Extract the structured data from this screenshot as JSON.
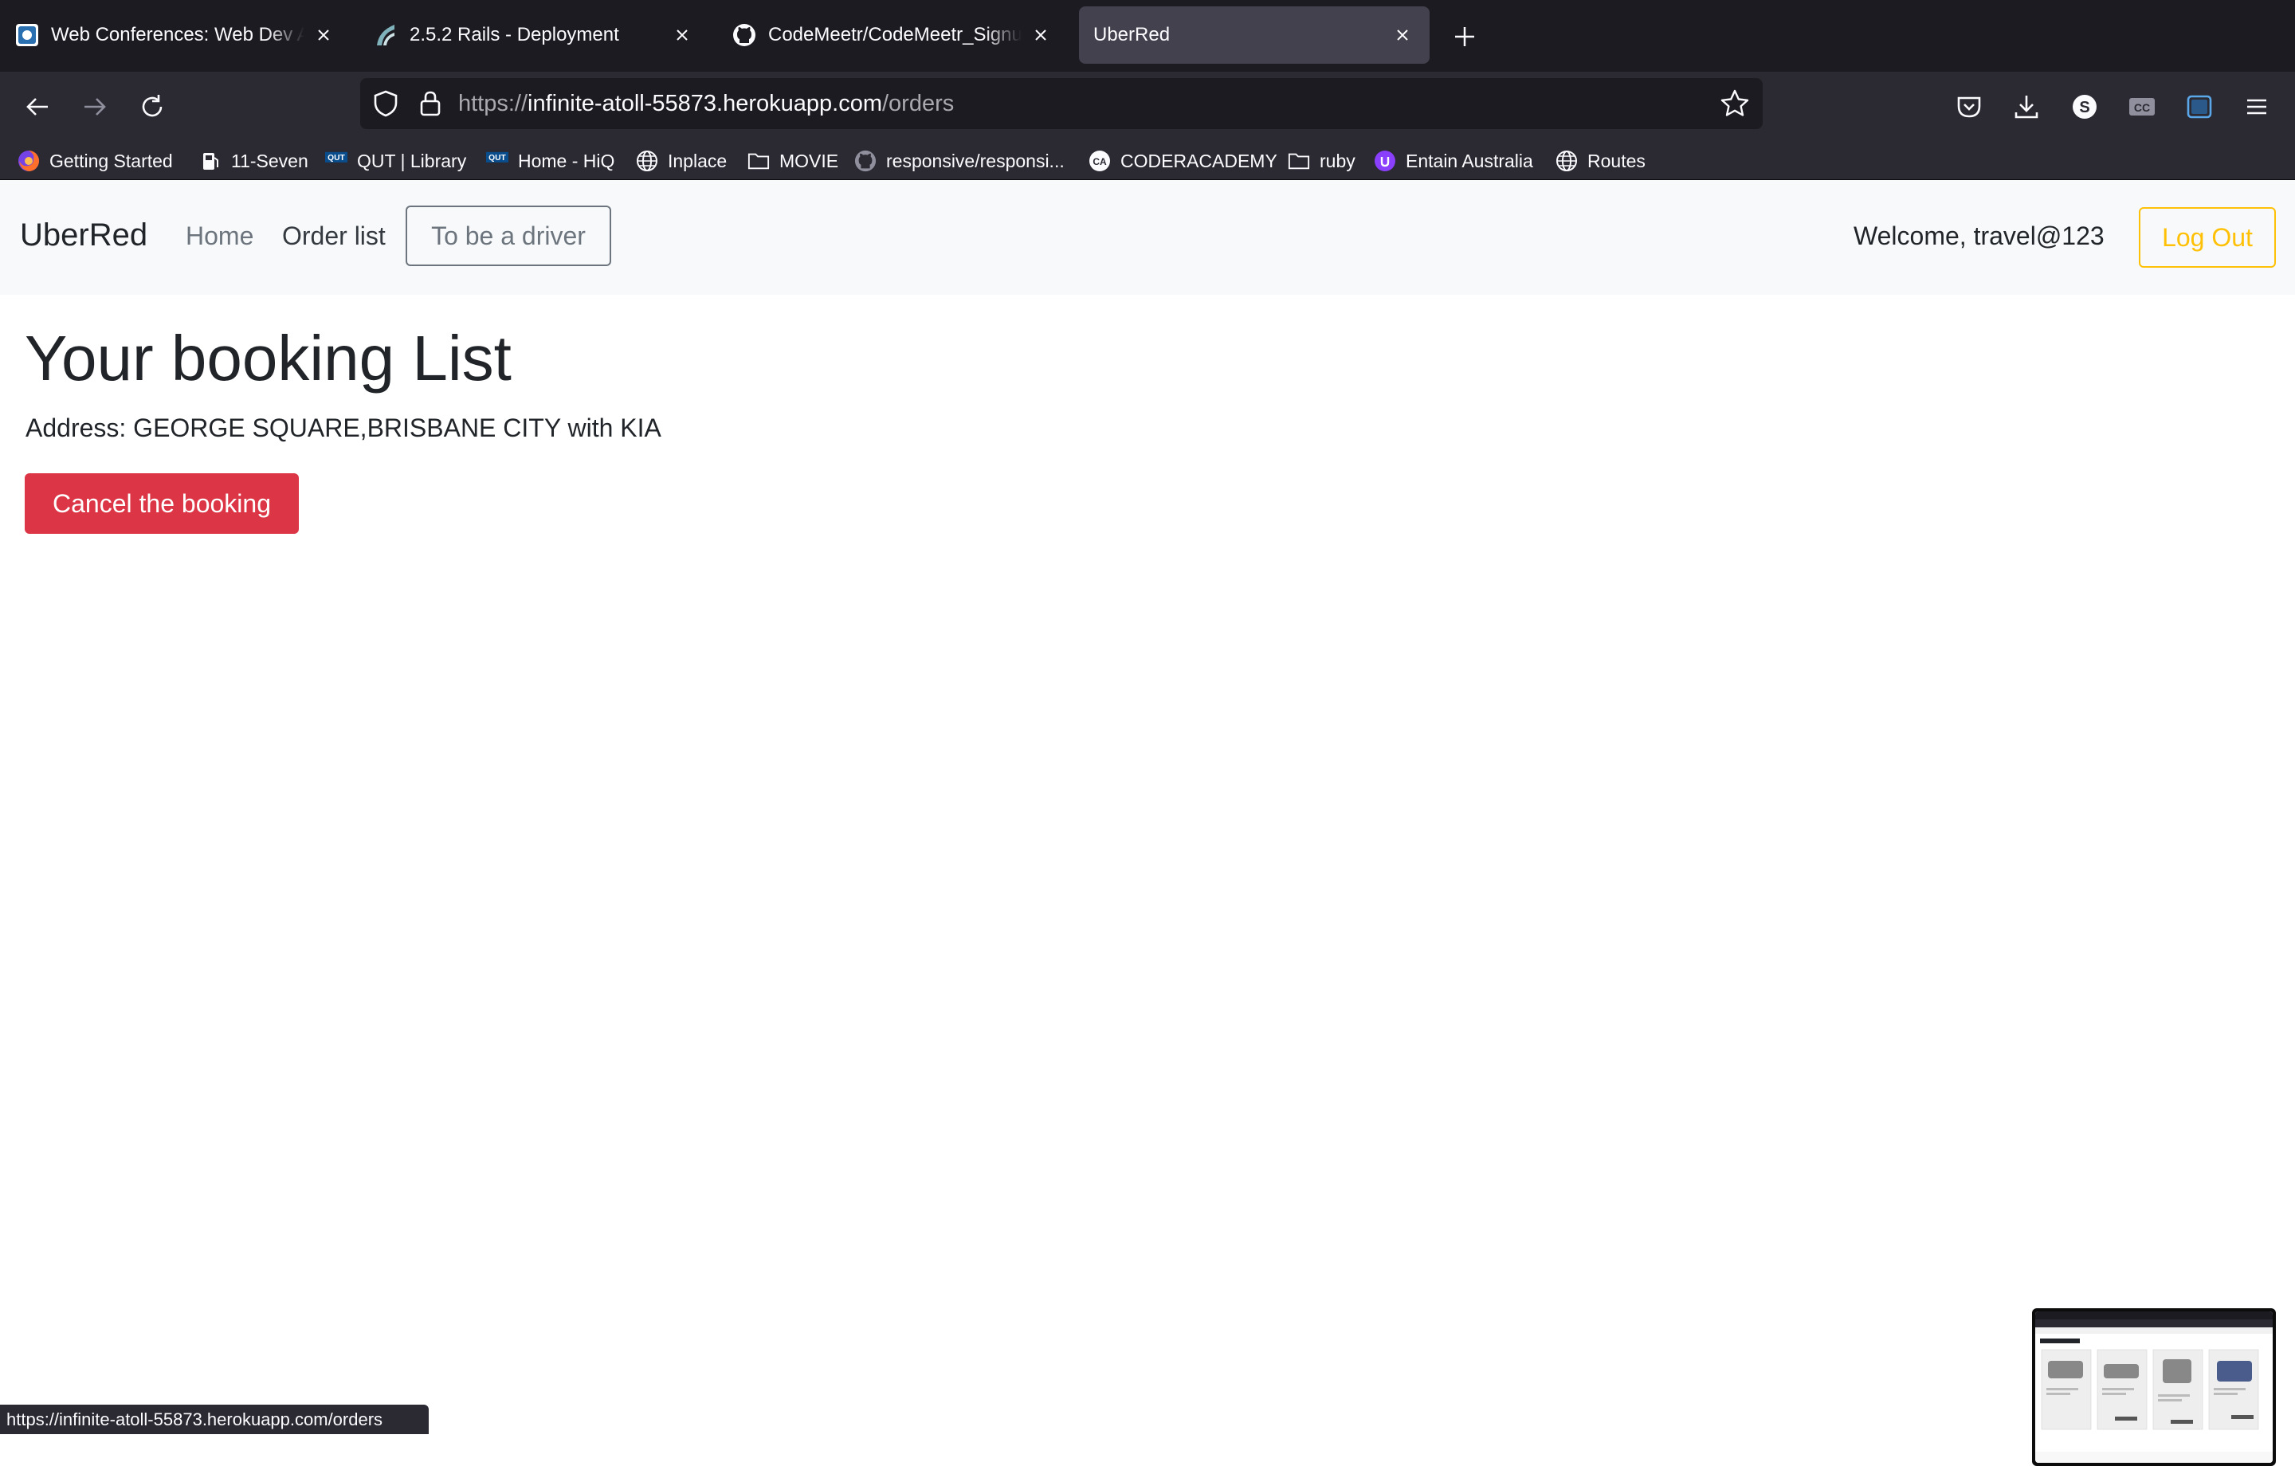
{
  "browser": {
    "tabs": [
      {
        "title": "Web Conferences: Web Dev Acc",
        "icon": "conference-icon",
        "active": false
      },
      {
        "title": "2.5.2 Rails - Deployment",
        "icon": "rails-icon",
        "active": false
      },
      {
        "title": "CodeMeetr/CodeMeetr_Signup.j",
        "icon": "github-icon",
        "active": false
      },
      {
        "title": "UberRed",
        "icon": "none",
        "active": true
      }
    ],
    "url": {
      "scheme": "https://",
      "host": "infinite-atoll-55873.herokuapp.com",
      "path": "/orders"
    },
    "bookmarks": [
      {
        "label": "Getting Started",
        "icon": "firefox-icon"
      },
      {
        "label": "11-Seven",
        "icon": "fuel-icon"
      },
      {
        "label": "QUT | Library",
        "icon": "qut-icon"
      },
      {
        "label": "Home - HiQ",
        "icon": "qut-icon"
      },
      {
        "label": "Inplace",
        "icon": "globe-icon"
      },
      {
        "label": "MOVIE",
        "icon": "folder-icon"
      },
      {
        "label": "responsive/responsi...",
        "icon": "github-icon"
      },
      {
        "label": "CODERACADEMY",
        "icon": "ca-icon"
      },
      {
        "label": "ruby",
        "icon": "folder-icon"
      },
      {
        "label": "Entain Australia",
        "icon": "entain-icon"
      },
      {
        "label": "Routes",
        "icon": "globe-icon"
      }
    ],
    "qut_badge": "QUT",
    "ca_badge": "CA",
    "status_url": "https://infinite-atoll-55873.herokuapp.com/orders",
    "ext_s_label": "S",
    "ext_cc_label": "CC"
  },
  "navbar": {
    "brand": "UberRed",
    "links": [
      "Home",
      "Order list"
    ],
    "driver_button": "To be a driver",
    "welcome": "Welcome, travel@123",
    "logout": "Log Out"
  },
  "main": {
    "heading": "Your booking List",
    "address": "Address: GEORGE SQUARE,BRISBANE CITY with KIA",
    "cancel_button": "Cancel the booking"
  },
  "colors": {
    "cancel": "#dc3545",
    "logout": "#ffc107",
    "navbar_bg": "#f8f9fa"
  }
}
